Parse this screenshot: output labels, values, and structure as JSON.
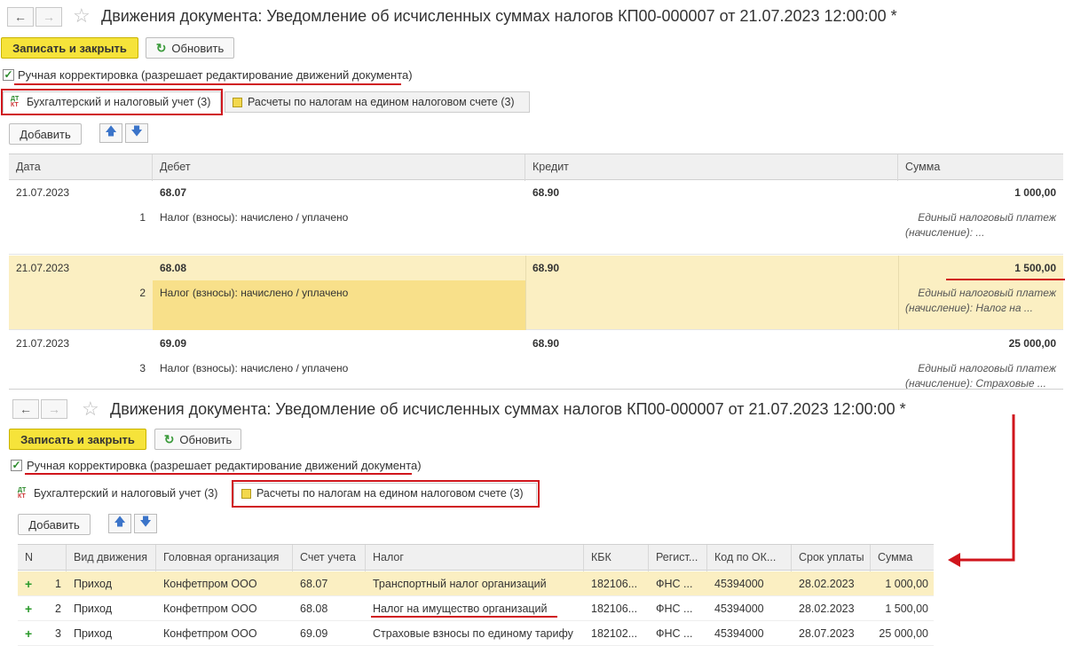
{
  "top": {
    "title": "Движения документа: Уведомление об исчисленных суммах налогов КП00-000007 от 21.07.2023 12:00:00 *",
    "save_close": "Записать и закрыть",
    "refresh": "Обновить",
    "manual_edit": "Ручная корректировка (разрешает редактирование движений документа)",
    "tabs": [
      {
        "label": "Бухгалтерский и налоговый учет (3)"
      },
      {
        "label": "Расчеты по налогам на едином налоговом счете (3)"
      }
    ],
    "add": "Добавить",
    "columns": [
      "Дата",
      "Дебет",
      "Кредит",
      "Сумма"
    ],
    "rows": [
      {
        "date": "21.07.2023",
        "num": "1",
        "debit": "68.07",
        "desc": "Налог (взносы): начислено / уплачено",
        "credit": "68.90",
        "sum": "1 000,00",
        "note1": "Единый налоговый платеж",
        "note2": "(начисление): ..."
      },
      {
        "date": "21.07.2023",
        "num": "2",
        "debit": "68.08",
        "desc": "Налог (взносы): начислено / уплачено",
        "credit": "68.90",
        "sum": "1 500,00",
        "note1": "Единый налоговый платеж",
        "note2": "(начисление): Налог на ..."
      },
      {
        "date": "21.07.2023",
        "num": "3",
        "debit": "69.09",
        "desc": "Налог (взносы): начислено / уплачено",
        "credit": "68.90",
        "sum": "25 000,00",
        "note1": "Единый налоговый платеж",
        "note2": "(начисление): Страховые ..."
      }
    ]
  },
  "bottom": {
    "title": "Движения документа: Уведомление об исчисленных суммах налогов КП00-000007 от 21.07.2023 12:00:00 *",
    "save_close": "Записать и закрыть",
    "refresh": "Обновить",
    "manual_edit": "Ручная корректировка (разрешает редактирование движений документа)",
    "tabs": [
      {
        "label": "Бухгалтерский и налоговый учет (3)"
      },
      {
        "label": "Расчеты по налогам на едином налоговом счете (3)"
      }
    ],
    "add": "Добавить",
    "columns": [
      "N",
      "Вид движения",
      "Головная организация",
      "Счет учета",
      "Налог",
      "КБК",
      "Регист...",
      "Код по ОК...",
      "Срок уплаты",
      "Сумма"
    ],
    "rows": [
      {
        "n": "1",
        "kind": "Приход",
        "org": "Конфетпром ООО",
        "account": "68.07",
        "tax": "Транспортный налог организаций",
        "kbk": "182106...",
        "reg": "ФНС ...",
        "okt": "45394000",
        "due": "28.02.2023",
        "sum": "1 000,00"
      },
      {
        "n": "2",
        "kind": "Приход",
        "org": "Конфетпром ООО",
        "account": "68.08",
        "tax": "Налог на имущество организаций",
        "kbk": "182106...",
        "reg": "ФНС ...",
        "okt": "45394000",
        "due": "28.02.2023",
        "sum": "1 500,00"
      },
      {
        "n": "3",
        "kind": "Приход",
        "org": "Конфетпром ООО",
        "account": "69.09",
        "tax": "Страховые взносы по единому тарифу",
        "kbk": "182102...",
        "reg": "ФНС ...",
        "okt": "45394000",
        "due": "28.07.2023",
        "sum": "25 000,00"
      }
    ]
  }
}
